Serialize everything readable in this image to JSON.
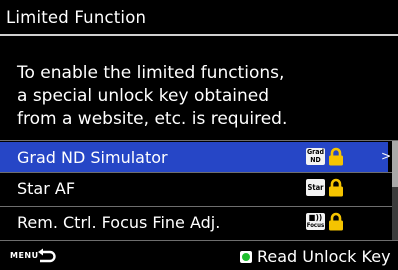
{
  "header": {
    "title": "Limited Function"
  },
  "message": {
    "lines": [
      "To enable the limited functions,",
      "a special unlock key obtained",
      "from a website, etc. is required."
    ]
  },
  "menu": {
    "items": [
      {
        "label": "Grad ND Simulator",
        "badge": [
          "Grad",
          "ND"
        ],
        "badge_icon": "grad-nd-icon",
        "status_icon": "lock-icon",
        "selected": true
      },
      {
        "label": "Star AF",
        "badge": [
          "Star"
        ],
        "badge_icon": "star-af-icon",
        "status_icon": "lock-icon",
        "selected": false
      },
      {
        "label": "Rem. Ctrl. Focus Fine Adj.",
        "badge": [
          "■))",
          "Focus"
        ],
        "badge_icon": "remote-focus-icon",
        "status_icon": "lock-icon",
        "selected": false
      }
    ],
    "selected_chevron": ">"
  },
  "footer": {
    "menu_label": "MENU",
    "back_icon": "back-arrow-icon",
    "action_icon": "green-button-icon",
    "action_label": "Read Unlock Key"
  },
  "colors": {
    "background": "#000000",
    "selection": "#2646c6",
    "lock": "#f5c400",
    "action_button": "#1fbf2f"
  }
}
